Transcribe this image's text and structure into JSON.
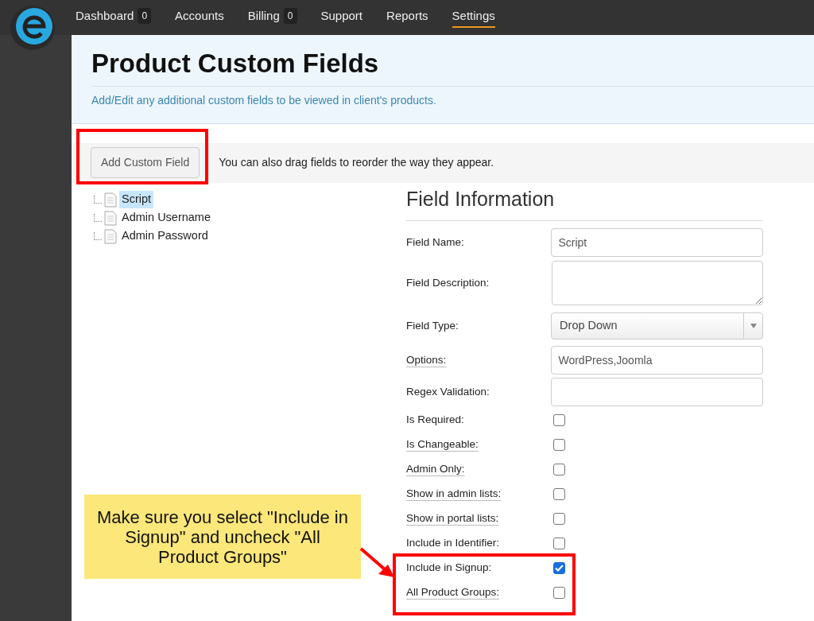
{
  "nav": [
    {
      "label": "Dashboard",
      "badge": "0",
      "selected": false
    },
    {
      "label": "Accounts",
      "selected": false
    },
    {
      "label": "Billing",
      "badge": "0",
      "selected": false
    },
    {
      "label": "Support",
      "selected": false
    },
    {
      "label": "Reports",
      "selected": false
    },
    {
      "label": "Settings",
      "selected": true
    }
  ],
  "page": {
    "title": "Product Custom Fields",
    "subtitle": "Add/Edit any additional custom fields to be viewed in client's products."
  },
  "toolbar": {
    "button": "Add Custom Field",
    "hint": "You can also drag fields to reorder the way they appear."
  },
  "tree": [
    {
      "label": "Script",
      "selected": true
    },
    {
      "label": "Admin Username",
      "selected": false
    },
    {
      "label": "Admin Password",
      "selected": false
    }
  ],
  "form": {
    "title": "Field Information",
    "rows": [
      {
        "kind": "text",
        "label": "Field Name:",
        "value": "Script",
        "tooltip": false
      },
      {
        "kind": "textarea",
        "label": "Field Description:",
        "tooltip": false
      },
      {
        "kind": "select",
        "label": "Field Type:",
        "value": "Drop Down",
        "tooltip": false
      },
      {
        "kind": "text",
        "label": "Options:",
        "value": "WordPress,Joomla",
        "tooltip": true
      },
      {
        "kind": "text",
        "label": "Regex Validation:",
        "tooltip": false
      },
      {
        "kind": "checkbox",
        "label": "Is Required:",
        "checked": false,
        "tooltip": false
      },
      {
        "kind": "checkbox",
        "label": "Is Changeable:",
        "checked": false,
        "tooltip": true
      },
      {
        "kind": "checkbox",
        "label": "Admin Only:",
        "checked": false,
        "tooltip": true
      },
      {
        "kind": "checkbox",
        "label": "Show in admin lists:",
        "checked": false,
        "tooltip": true
      },
      {
        "kind": "checkbox",
        "label": "Show in portal lists:",
        "checked": false,
        "tooltip": true
      },
      {
        "kind": "checkbox",
        "label": "Include in Identifier:",
        "checked": false,
        "tooltip": false
      },
      {
        "kind": "checkbox",
        "label": "Include in Signup:",
        "checked": true,
        "tooltip": false
      },
      {
        "kind": "checkbox",
        "label": "All Product Groups:",
        "checked": false,
        "tooltip": true
      }
    ]
  },
  "annotation": {
    "text": "Make sure you select \"Include in Signup\" and uncheck \"All Product Groups\""
  }
}
